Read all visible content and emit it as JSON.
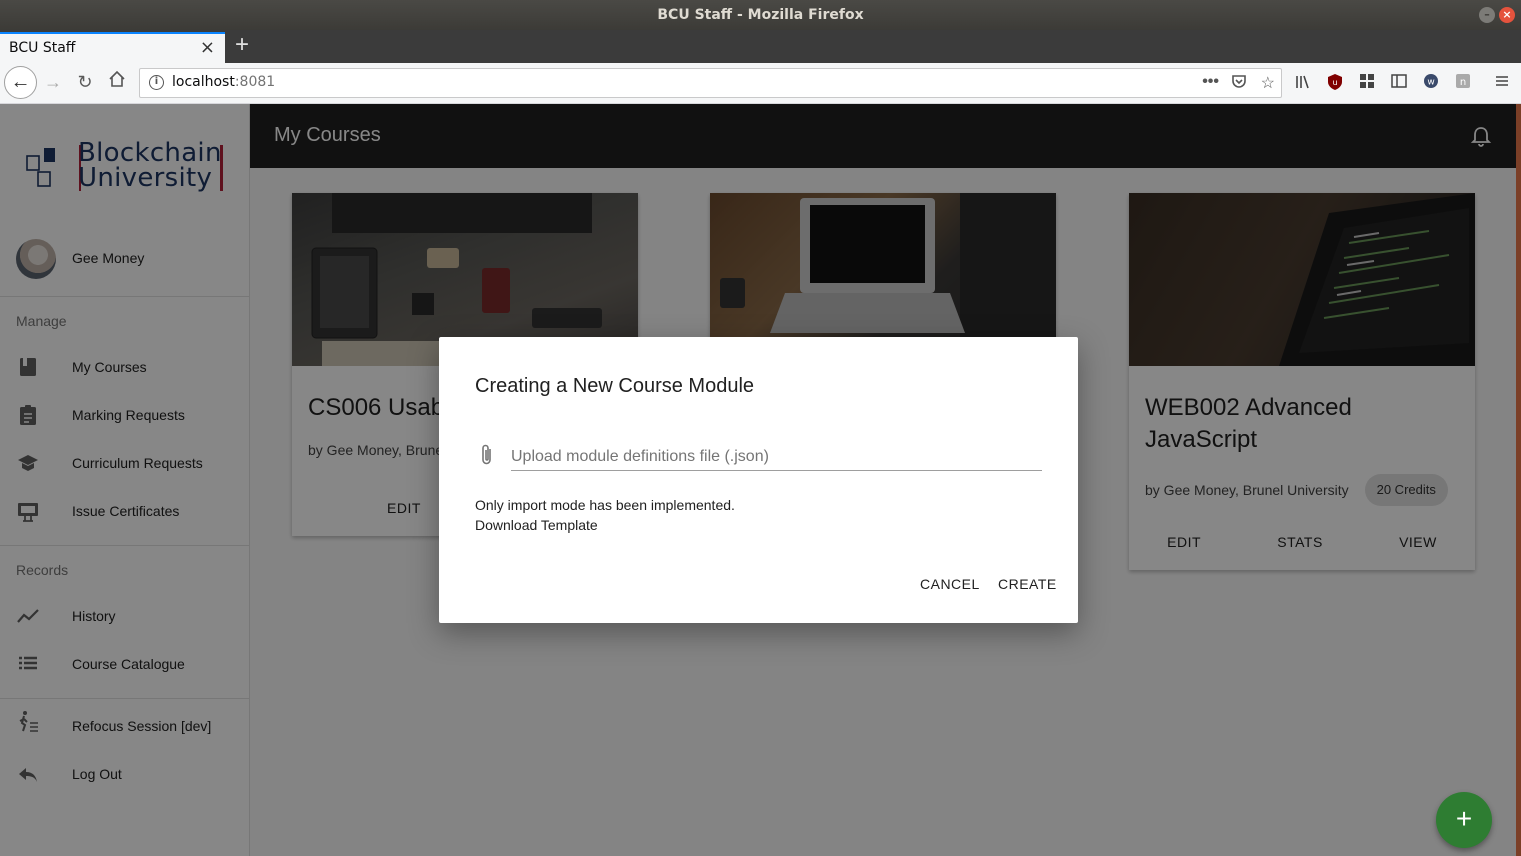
{
  "window": {
    "title": "BCU Staff - Mozilla Firefox"
  },
  "browser": {
    "tab_title": "BCU Staff",
    "url_host": "localhost",
    "url_port": ":8081",
    "new_tab_label": "+"
  },
  "sidebar": {
    "logo_line1": "Blockchain",
    "logo_line2": "University",
    "user_name": "Gee Money",
    "manage_header": "Manage",
    "records_header": "Records",
    "manage_items": [
      {
        "label": "My Courses",
        "icon": "book-icon"
      },
      {
        "label": "Marking Requests",
        "icon": "clipboard-icon"
      },
      {
        "label": "Curriculum Requests",
        "icon": "school-icon"
      },
      {
        "label": "Issue Certificates",
        "icon": "certificate-icon"
      }
    ],
    "records_items": [
      {
        "label": "History",
        "icon": "trend-icon"
      },
      {
        "label": "Course Catalogue",
        "icon": "list-icon"
      }
    ],
    "other_items": [
      {
        "label": "Refocus Session [dev]",
        "icon": "walk-icon"
      },
      {
        "label": "Log Out",
        "icon": "reply-icon"
      }
    ]
  },
  "topbar": {
    "title": "My Courses"
  },
  "cards": [
    {
      "title": "CS006 Usab",
      "byline": "by Gee Money, Brune",
      "actions": [
        "EDIT"
      ]
    },
    {
      "title": "WEB002 Advanced JavaScript",
      "byline": "by Gee Money, Brunel University",
      "credits": "20 Credits",
      "actions": [
        "EDIT",
        "STATS",
        "VIEW"
      ]
    }
  ],
  "fab": {
    "label": "+"
  },
  "dialog": {
    "title": "Creating a New Course Module",
    "upload_placeholder": "Upload module definitions file (.json)",
    "note": "Only import mode has been implemented.",
    "template_link": "Download Template",
    "cancel": "CANCEL",
    "create": "CREATE"
  },
  "colors": {
    "topbar": "#212121",
    "fab": "#2e7d32",
    "logo_text": "#1e3563",
    "logo_accent": "#b3203a"
  }
}
